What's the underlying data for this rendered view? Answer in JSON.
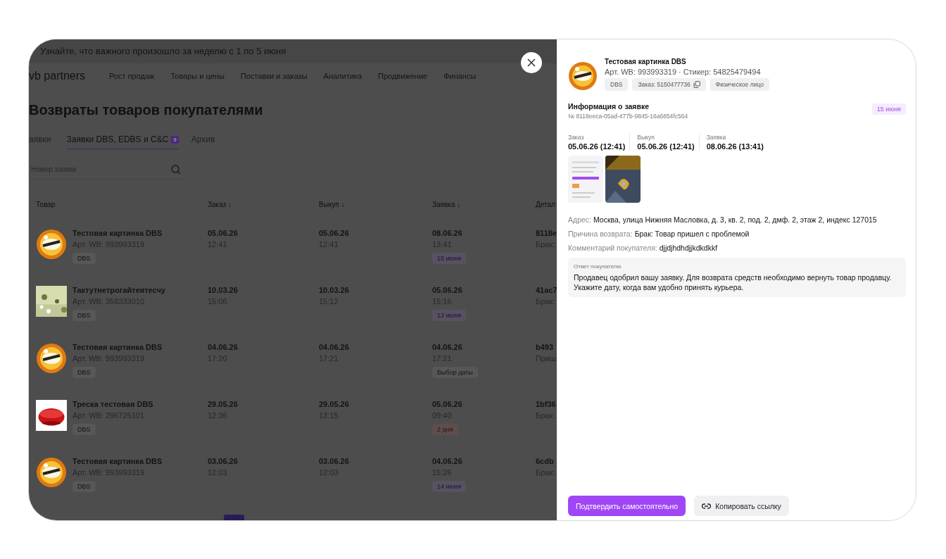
{
  "banner": {
    "text": "Узнайте, что важного произошло за неделю с 1 по 5 июня"
  },
  "header": {
    "logo": "vb partners",
    "nav": [
      "Рост продаж",
      "Товары и цены",
      "Поставки и заказы",
      "Аналитика",
      "Продвижение",
      "Финансы"
    ]
  },
  "page": {
    "title": "Возвраты товаров покупателями",
    "tabs": [
      {
        "label": "аявки",
        "selected": false
      },
      {
        "label": "Заявки DBS, EDBS и C&C",
        "badge": "9",
        "selected": true
      },
      {
        "label": "Архив",
        "selected": false
      }
    ],
    "search": {
      "placeholder": "Номер заявки"
    }
  },
  "table": {
    "columns": [
      "Товар",
      "Заказ ↓",
      "Выкуп ↓",
      "Заявка ↓",
      "Детал"
    ],
    "rows": [
      {
        "image": {
          "kind": "picture"
        },
        "name": "Тестовая картинка DBS",
        "article": "Арт. WB: 993993319",
        "tag": "DBS",
        "order": [
          "05.06.26",
          "12:41"
        ],
        "buyout": [
          "05.06.26",
          "12:41"
        ],
        "request": [
          "08.06.26",
          "13:41"
        ],
        "deadline": {
          "text": "15 июня",
          "kind": "purple"
        },
        "details": [
          "8118e",
          "Брак:"
        ]
      },
      {
        "image": {
          "kind": "picture"
        },
        "name": "Тактутнетрогайтеятесчу",
        "article": "Арт. WB: 358333010",
        "tag": "DBS",
        "order": [
          "10.03.26",
          "15:06"
        ],
        "buyout": [
          "10.03.26",
          "15:12"
        ],
        "request": [
          "05.06.26",
          "15:16"
        ],
        "deadline": {
          "text": "13 июня",
          "kind": "purple"
        },
        "details": [
          "41ac7",
          "Брак:"
        ]
      },
      {
        "image": {
          "kind": "picture"
        },
        "name": "Тестовая картинка DBS",
        "article": "Арт. WB: 993993319",
        "tag": "DBS",
        "order": [
          "04.06.26",
          "17:20"
        ],
        "buyout": [
          "04.06.26",
          "17:21"
        ],
        "request": [
          "04.06.26",
          "17:21"
        ],
        "deadline": {
          "text": "Выбор даты",
          "kind": "grey"
        },
        "details": [
          "b493",
          "Приш"
        ]
      },
      {
        "image": {
          "kind": "picture"
        },
        "name": "Треска тестовая DBS",
        "article": "Арт. WB: 296725101",
        "tag": "DBS",
        "order": [
          "29.05.26",
          "12:36"
        ],
        "buyout": [
          "29.05.26",
          "13:15"
        ],
        "request": [
          "05.06.26",
          "09:40"
        ],
        "deadline": {
          "text": "2 дня",
          "kind": "red"
        },
        "details": [
          "1bf36",
          "Брак:"
        ]
      },
      {
        "image": {
          "kind": "picture"
        },
        "name": "Тестовая картинка DBS",
        "article": "Арт. WB: 993993319",
        "tag": "DBS",
        "order": [
          "03.06.26",
          "12:03"
        ],
        "buyout": [
          "03.06.26",
          "12:03"
        ],
        "request": [
          "04.06.26",
          "15:26"
        ],
        "deadline": {
          "text": "14 июня",
          "kind": "purple"
        },
        "details": [
          "6cdb",
          "Брак:"
        ]
      }
    ]
  },
  "drawer": {
    "product": {
      "image": {
        "kind": "picture"
      },
      "title": "Тестовая картинка DBS",
      "meta": "Арт. WB: 993993319 · Стикер: 54825479494",
      "chips": [
        {
          "text": "DBS",
          "copy": false
        },
        {
          "text": "Заказ: 5150477736",
          "copy": true
        },
        {
          "text": "Физическое лицо",
          "copy": false
        }
      ]
    },
    "info": {
      "title": "Информация о заявке",
      "number": "№ 8118eeca-05ad-477b-9845-16a6854fc564",
      "badge": "15 июня"
    },
    "dates": [
      {
        "label": "Заказ",
        "value": "05.06.26 (12:41)"
      },
      {
        "label": "Выкуп",
        "value": "05.06.26 (12:41)"
      },
      {
        "label": "Заявка",
        "value": "08.06.26 (13:41)"
      }
    ],
    "attachments": [
      {
        "kind": "picture"
      },
      {
        "kind": "picture"
      }
    ],
    "details": [
      {
        "label": "Адрес:",
        "value": "Москва, улица Нижняя Масловка, д. 3, кв. 2, под. 2, дмф. 2, этаж 2, индекс 127015"
      },
      {
        "label": "Причина возврата:",
        "value": "Брак: Товар пришел с проблемой"
      },
      {
        "label": "Комментарий покупателя:",
        "value": "djjdjhdhdjjkdkdkkf"
      }
    ],
    "answer": {
      "label": "Ответ покупателю",
      "text": "Продавец одобрил вашу заявку. Для возврата средств необходимо вернуть товар продавцу. Укажите дату, когда вам удобно принять курьера."
    },
    "buttons": [
      {
        "label": "Подтвердить самостоятельно",
        "kind": "primary"
      },
      {
        "label": "Копировать ссылку",
        "kind": "secondary"
      }
    ]
  }
}
